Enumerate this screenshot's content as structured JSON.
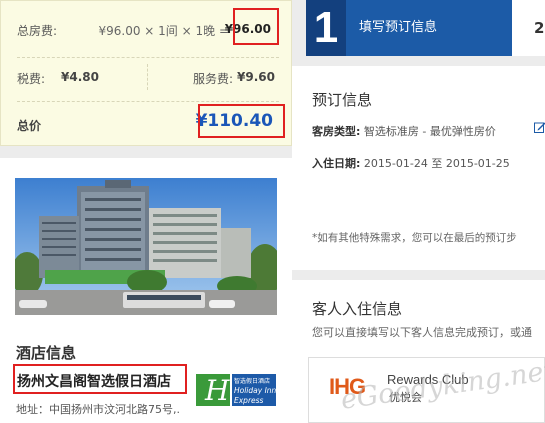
{
  "price_summary": {
    "room_fee_label": "总房费:",
    "room_fee_formula": "¥96.00 × 1间 × 1晚 =",
    "room_fee_amount": "¥96.00",
    "tax_label": "税费:",
    "tax_amount": "¥4.80",
    "service_label": "服务费:",
    "service_amount": "¥9.60",
    "total_label": "总价",
    "total_amount": "¥110.40"
  },
  "steps": {
    "current_number": "1",
    "current_label": "填写预订信息",
    "next_number": "2"
  },
  "booking": {
    "title": "预订信息",
    "room_type_label": "客房类型:",
    "room_type_value": "智选标准房 - 最优弹性房价",
    "date_label": "入住日期:",
    "date_value": "2015-01-24 至 2015-01-25",
    "note": "*如有其他特殊需求，您可以在最后的预订步"
  },
  "guest": {
    "title": "客人入住信息",
    "hint": "您可以直接填写以下客人信息完成预订，或通",
    "rewards_logo": "IHG",
    "rewards_name": "Rewards Club",
    "rewards_sub": "优悦会"
  },
  "hotel": {
    "section_title": "酒店信息",
    "name": "扬州文昌阁智选假日酒店",
    "address": "地址：中国扬州市汶河北路75号,.",
    "logo_line1": "智选假日酒店",
    "logo_line2": "Holiday Inn",
    "logo_line3": "Express"
  },
  "watermark": "eGoodyking.net",
  "colors": {
    "price_panel_bg": "#fbfbe3",
    "highlight_red": "#e02020",
    "total_blue": "#1a56b8",
    "step_dark": "#13407e",
    "step_active": "#1c5ba7",
    "express_green": "#3a9a3a",
    "ihg_orange": "#e05a1a"
  }
}
